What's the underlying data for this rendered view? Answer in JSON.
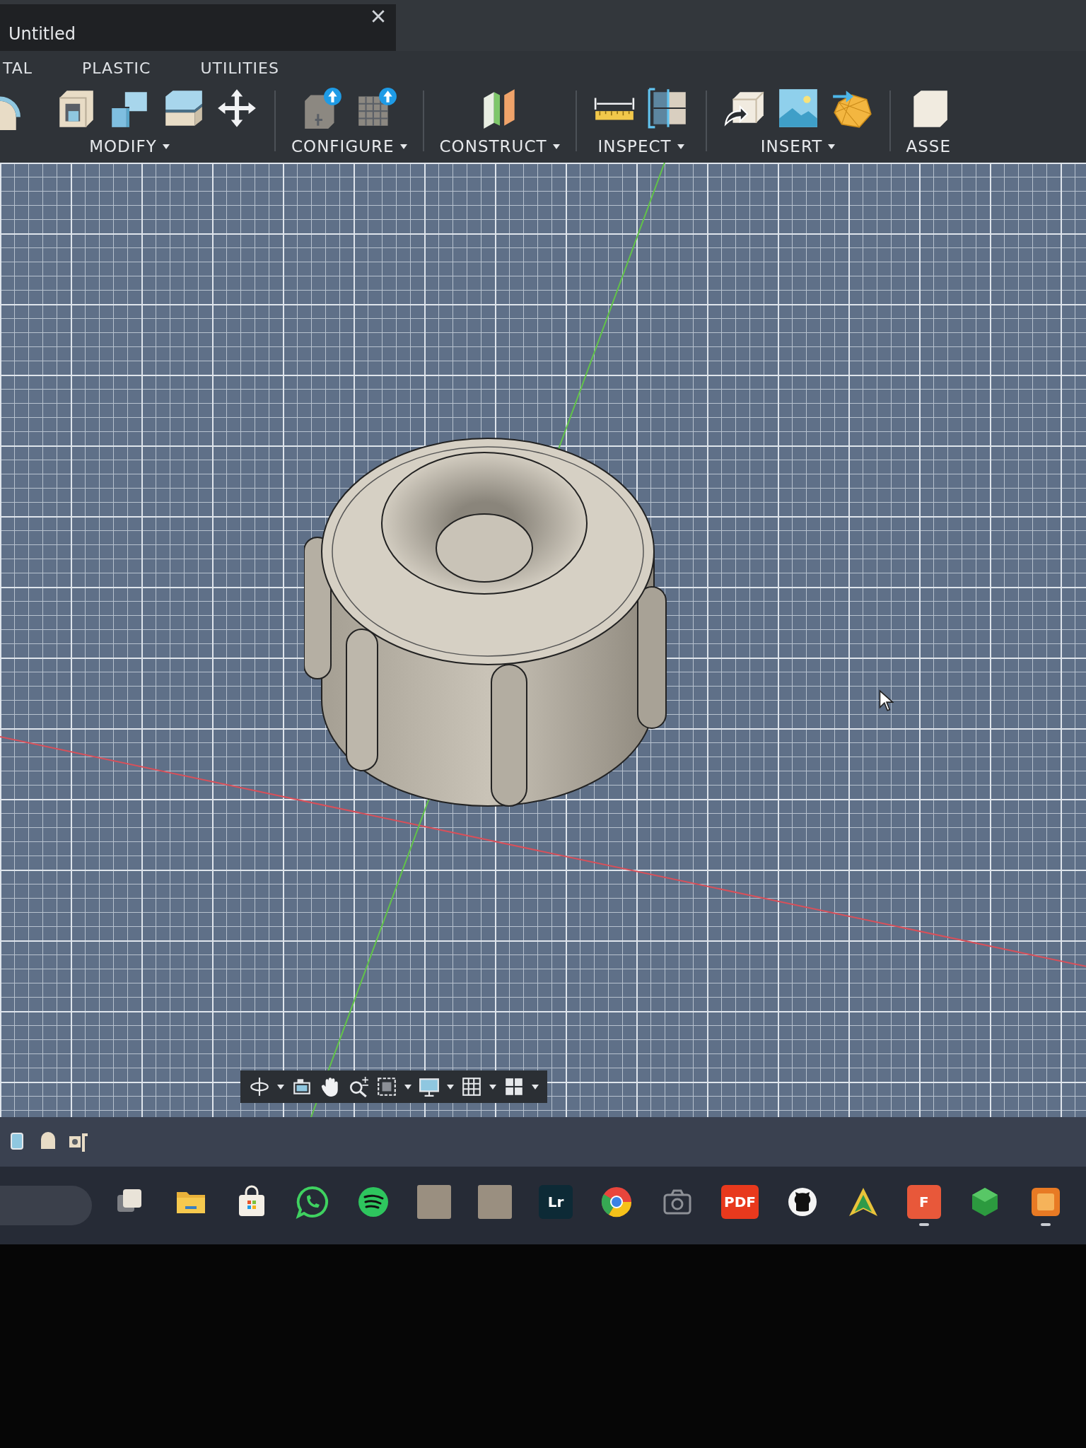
{
  "document_tab": {
    "title": "Untitled"
  },
  "tabs": [
    {
      "label": "TAL",
      "selected": false
    },
    {
      "label": "PLASTIC",
      "selected": false
    },
    {
      "label": "UTILITIES",
      "selected": false
    }
  ],
  "ribbon": [
    {
      "label": "MODIFY",
      "dropdown": true,
      "tools": [
        {
          "kind": "fillet"
        },
        {
          "kind": "shell"
        },
        {
          "kind": "combine"
        },
        {
          "kind": "split"
        },
        {
          "kind": "move"
        }
      ]
    },
    {
      "label": "CONFIGURE",
      "dropdown": true,
      "tools": [
        {
          "kind": "config-part"
        },
        {
          "kind": "config-table"
        }
      ]
    },
    {
      "label": "CONSTRUCT",
      "dropdown": true,
      "tools": [
        {
          "kind": "planes"
        }
      ]
    },
    {
      "label": "INSPECT",
      "dropdown": true,
      "tools": [
        {
          "kind": "measure"
        },
        {
          "kind": "section"
        }
      ]
    },
    {
      "label": "INSERT",
      "dropdown": true,
      "tools": [
        {
          "kind": "derive"
        },
        {
          "kind": "image"
        },
        {
          "kind": "mesh"
        }
      ]
    },
    {
      "label": "ASSE",
      "dropdown": false,
      "tools": [
        {
          "kind": "block"
        }
      ]
    }
  ],
  "navigation_bar": [
    {
      "kind": "orbit",
      "dropdown": true
    },
    {
      "kind": "look",
      "dropdown": false
    },
    {
      "kind": "pan",
      "dropdown": false
    },
    {
      "kind": "zoom",
      "dropdown": false
    },
    {
      "kind": "fit",
      "dropdown": true
    },
    {
      "kind": "display",
      "dropdown": true
    },
    {
      "kind": "grid",
      "dropdown": true
    },
    {
      "kind": "viewports",
      "dropdown": true
    }
  ],
  "timeline": [
    {
      "kind": "body"
    },
    {
      "kind": "shape"
    },
    {
      "kind": "part"
    }
  ],
  "taskbar": [
    {
      "kind": "task-view",
      "running": false
    },
    {
      "kind": "folder",
      "running": false
    },
    {
      "kind": "store",
      "running": false
    },
    {
      "kind": "chat",
      "running": false
    },
    {
      "kind": "waves",
      "running": false
    },
    {
      "kind": "photo",
      "running": false
    },
    {
      "kind": "photo",
      "running": false
    },
    {
      "kind": "tile",
      "label": "Lr",
      "color": "#0d2a36",
      "running": false
    },
    {
      "kind": "tricolor",
      "running": false
    },
    {
      "kind": "camera",
      "running": false
    },
    {
      "kind": "tile",
      "label": "PDF",
      "color": "#e8391d",
      "running": false
    },
    {
      "kind": "round-logo",
      "running": false
    },
    {
      "kind": "triangle",
      "running": false
    },
    {
      "kind": "tile",
      "label": "F",
      "color": "#e8583a",
      "running": true
    },
    {
      "kind": "hexagon",
      "running": false
    },
    {
      "kind": "square-logo",
      "running": true
    }
  ]
}
